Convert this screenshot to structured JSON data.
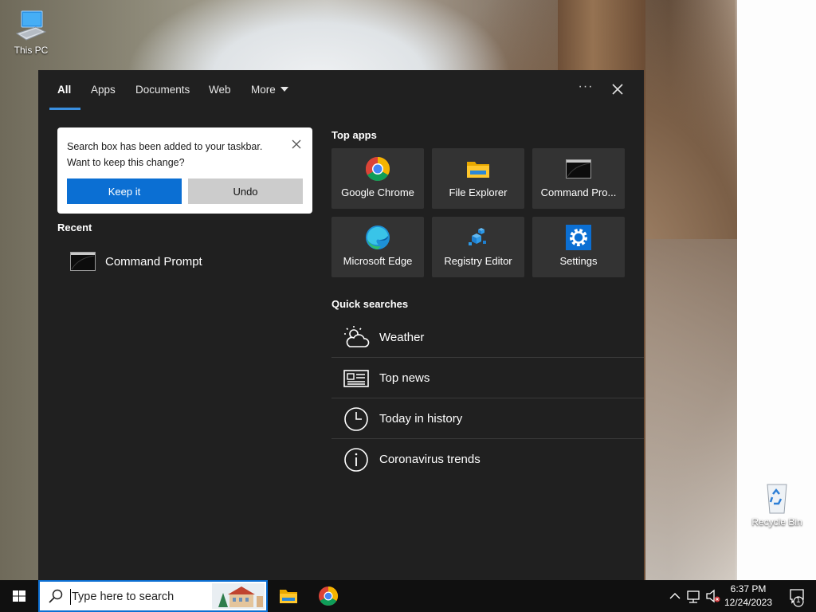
{
  "desktop": {
    "icons": [
      {
        "label": "This PC",
        "icon": "this-pc-icon"
      },
      {
        "label": "Recycle Bin",
        "icon": "recycle-bin-icon"
      }
    ]
  },
  "search_panel": {
    "tabs": [
      {
        "label": "All",
        "active": true
      },
      {
        "label": "Apps"
      },
      {
        "label": "Documents"
      },
      {
        "label": "Web"
      },
      {
        "label": "More"
      }
    ],
    "options_label": "···",
    "toast": {
      "message": "Search box has been added to your taskbar. Want to keep this change?",
      "keep_label": "Keep it",
      "undo_label": "Undo"
    },
    "recent": {
      "heading": "Recent",
      "items": [
        {
          "label": "Command Prompt",
          "icon": "command-prompt-icon"
        }
      ]
    },
    "top_apps": {
      "heading": "Top apps",
      "items": [
        {
          "label": "Google Chrome",
          "icon": "chrome-icon"
        },
        {
          "label": "File Explorer",
          "icon": "file-explorer-icon"
        },
        {
          "label": "Command Pro...",
          "icon": "command-prompt-icon"
        },
        {
          "label": "Microsoft Edge",
          "icon": "edge-icon"
        },
        {
          "label": "Registry Editor",
          "icon": "registry-editor-icon"
        },
        {
          "label": "Settings",
          "icon": "settings-gear-icon"
        }
      ]
    },
    "quick_searches": {
      "heading": "Quick searches",
      "items": [
        {
          "label": "Weather",
          "icon": "weather-icon"
        },
        {
          "label": "Top news",
          "icon": "news-icon"
        },
        {
          "label": "Today in history",
          "icon": "clock-icon"
        },
        {
          "label": "Coronavirus trends",
          "icon": "info-icon"
        }
      ]
    }
  },
  "taskbar": {
    "search_placeholder": "Type here to search",
    "pinned": [
      {
        "name": "File Explorer",
        "icon": "file-explorer-icon"
      },
      {
        "name": "Google Chrome",
        "icon": "chrome-icon"
      }
    ],
    "clock": {
      "time": "6:37 PM",
      "date": "12/24/2023"
    },
    "notification_count": "1",
    "colors": {
      "accent": "#0b6fd3",
      "panel": "#202020",
      "tile": "#333333"
    }
  }
}
